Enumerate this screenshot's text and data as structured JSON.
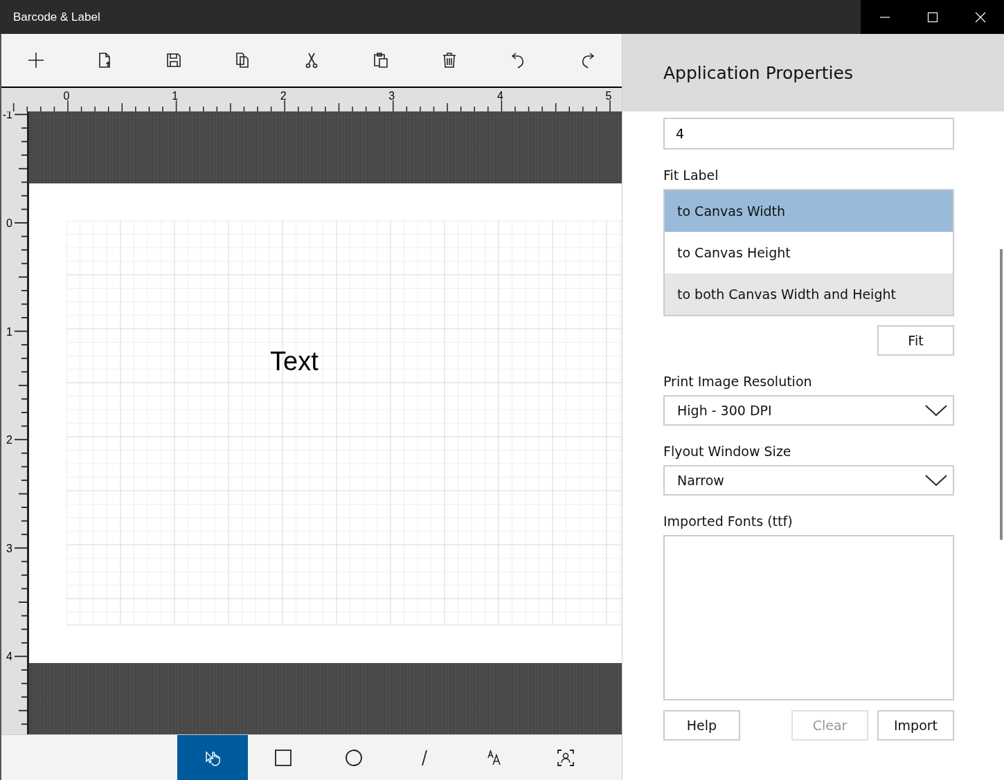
{
  "window": {
    "title": "Barcode & Label"
  },
  "ruler_top": {
    "labels": [
      "0",
      "1",
      "2",
      "3",
      "4",
      "5"
    ]
  },
  "ruler_left": {
    "labels": [
      "-1",
      "0",
      "1",
      "2",
      "3",
      "4"
    ]
  },
  "canvas": {
    "items": [
      {
        "kind": "text",
        "text": "Text"
      }
    ]
  },
  "tools": [
    {
      "kind": "pointer",
      "selected": true
    },
    {
      "kind": "rectangle",
      "selected": false
    },
    {
      "kind": "ellipse",
      "selected": false
    },
    {
      "kind": "line",
      "selected": false
    },
    {
      "kind": "text",
      "selected": false
    },
    {
      "kind": "image",
      "selected": false
    }
  ],
  "panel": {
    "title": "Application Properties",
    "top_field": {
      "value": "4"
    },
    "fit_label": {
      "label": "Fit Label",
      "options": [
        {
          "text": "to Canvas Width",
          "selected": true,
          "hovered": false
        },
        {
          "text": "to Canvas Height",
          "selected": false,
          "hovered": false
        },
        {
          "text": "to both Canvas Width and Height",
          "selected": false,
          "hovered": true
        }
      ],
      "button": "Fit"
    },
    "resolution": {
      "label": "Print Image Resolution",
      "value": "High - 300 DPI"
    },
    "flyout": {
      "label": "Flyout Window Size",
      "value": "Narrow"
    },
    "fonts": {
      "label": "Imported Fonts (ttf)",
      "buttons": [
        {
          "text": "Help",
          "disabled": false
        },
        {
          "text": "Clear",
          "disabled": true
        },
        {
          "text": "Import",
          "disabled": false
        }
      ]
    }
  }
}
